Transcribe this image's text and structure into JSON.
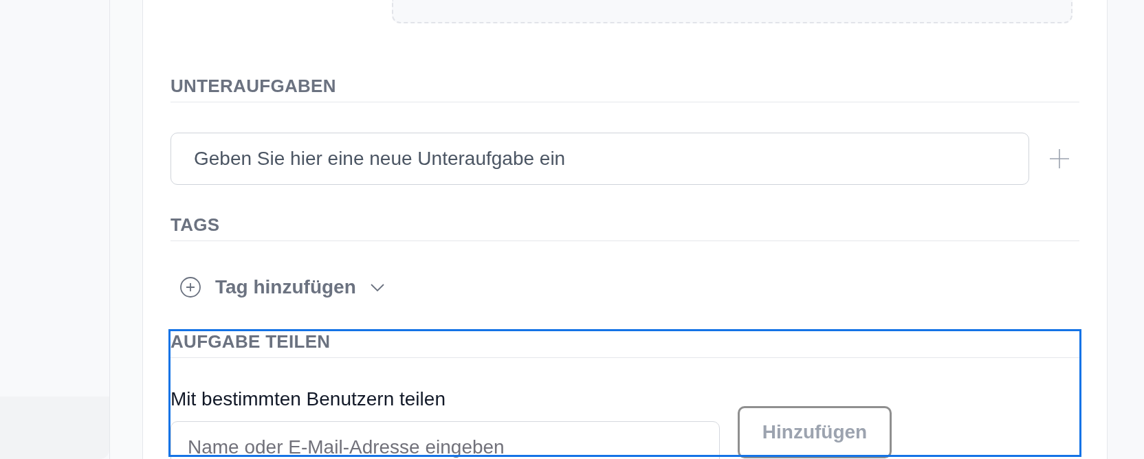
{
  "subtasks": {
    "heading": "UNTERAUFGABEN",
    "input": {
      "placeholder": "Geben Sie hier eine neue Unteraufgabe ein"
    }
  },
  "tags": {
    "heading": "TAGS",
    "add_button": {
      "label": "Tag hinzufügen"
    }
  },
  "share": {
    "heading": "AUFGABE TEILEN",
    "focused": true,
    "label": "Mit bestimmten Benutzern teilen",
    "input": {
      "placeholder": "Name oder E-Mail-Adresse eingeben"
    },
    "button": {
      "label": "Hinzufügen",
      "disabled": true
    }
  }
}
